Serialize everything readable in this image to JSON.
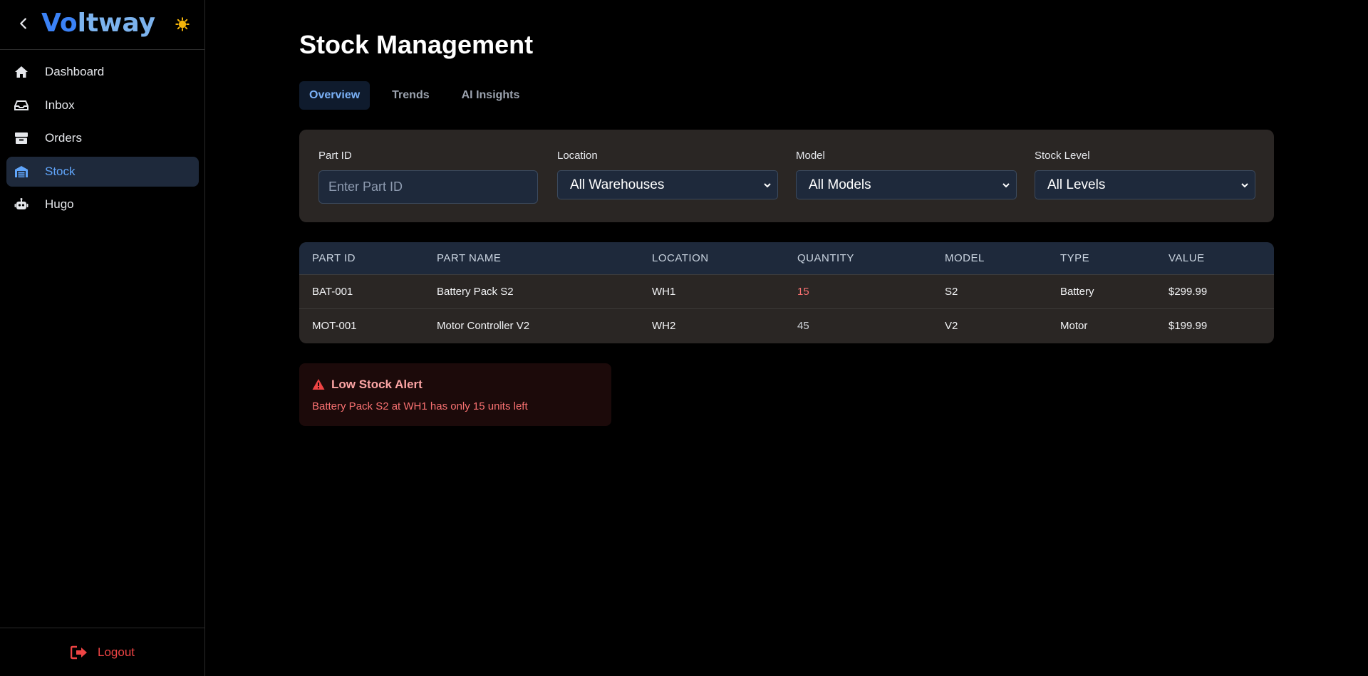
{
  "app": {
    "logo_part1": "Vo",
    "logo_part2": "ltway"
  },
  "sidebar": {
    "items": [
      {
        "label": "Dashboard",
        "icon": "home-icon"
      },
      {
        "label": "Inbox",
        "icon": "inbox-icon"
      },
      {
        "label": "Orders",
        "icon": "box-icon"
      },
      {
        "label": "Stock",
        "icon": "warehouse-icon",
        "active": true
      },
      {
        "label": "Hugo",
        "icon": "robot-icon"
      }
    ],
    "logout_label": "Logout"
  },
  "main": {
    "title": "Stock Management",
    "tabs": [
      {
        "label": "Overview",
        "active": true
      },
      {
        "label": "Trends"
      },
      {
        "label": "AI Insights"
      }
    ],
    "filters": {
      "part_id": {
        "label": "Part ID",
        "placeholder": "Enter Part ID"
      },
      "location": {
        "label": "Location",
        "value": "All Warehouses"
      },
      "model": {
        "label": "Model",
        "value": "All Models"
      },
      "stock_level": {
        "label": "Stock Level",
        "value": "All Levels"
      }
    },
    "table": {
      "columns": [
        "PART ID",
        "PART NAME",
        "LOCATION",
        "QUANTITY",
        "MODEL",
        "TYPE",
        "VALUE"
      ],
      "rows": [
        [
          "BAT-001",
          "Battery Pack S2",
          "WH1",
          "15",
          "S2",
          "Battery",
          "$299.99"
        ],
        [
          "MOT-001",
          "Motor Controller V2",
          "WH2",
          "45",
          "V2",
          "Motor",
          "$199.99"
        ]
      ]
    },
    "alert": {
      "title": "Low Stock Alert",
      "message": "Battery Pack S2 at WH1 has only 15 units left"
    }
  },
  "colors": {
    "accent": "#60a5fa",
    "danger": "#ef4444",
    "panel": "#2a2624",
    "header": "#1e293b"
  }
}
